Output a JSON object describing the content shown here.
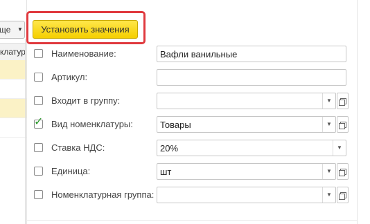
{
  "left_panel": {
    "button_label": "ще",
    "column_header": "клатур",
    "rows": [
      {
        "highlighted": true
      },
      {
        "highlighted": false
      },
      {
        "highlighted": true
      },
      {
        "highlighted": false
      }
    ]
  },
  "toolbar": {
    "set_values_label": "Установить значения"
  },
  "form": {
    "fields": [
      {
        "label": "Наименование:",
        "checked": false,
        "value": "Вафли ванильные",
        "dropdown": false,
        "open": false
      },
      {
        "label": "Артикул:",
        "checked": false,
        "value": "",
        "dropdown": false,
        "open": false
      },
      {
        "label": "Входит в группу:",
        "checked": false,
        "value": "",
        "dropdown": true,
        "open": true
      },
      {
        "label": "Вид номенклатуры:",
        "checked": true,
        "value": "Товары",
        "dropdown": true,
        "open": true
      },
      {
        "label": "Ставка НДС:",
        "checked": false,
        "value": "20%",
        "dropdown": true,
        "open": false
      },
      {
        "label": "Единица:",
        "checked": false,
        "value": "шт",
        "dropdown": true,
        "open": true
      },
      {
        "label": "Номенклатурная группа:",
        "checked": false,
        "value": "",
        "dropdown": true,
        "open": true
      }
    ]
  },
  "colors": {
    "accent_button": "#f5cf00",
    "highlight_frame": "#e0393e",
    "check_mark": "#2c9a2c",
    "row_highlight": "#fbf2c6"
  }
}
